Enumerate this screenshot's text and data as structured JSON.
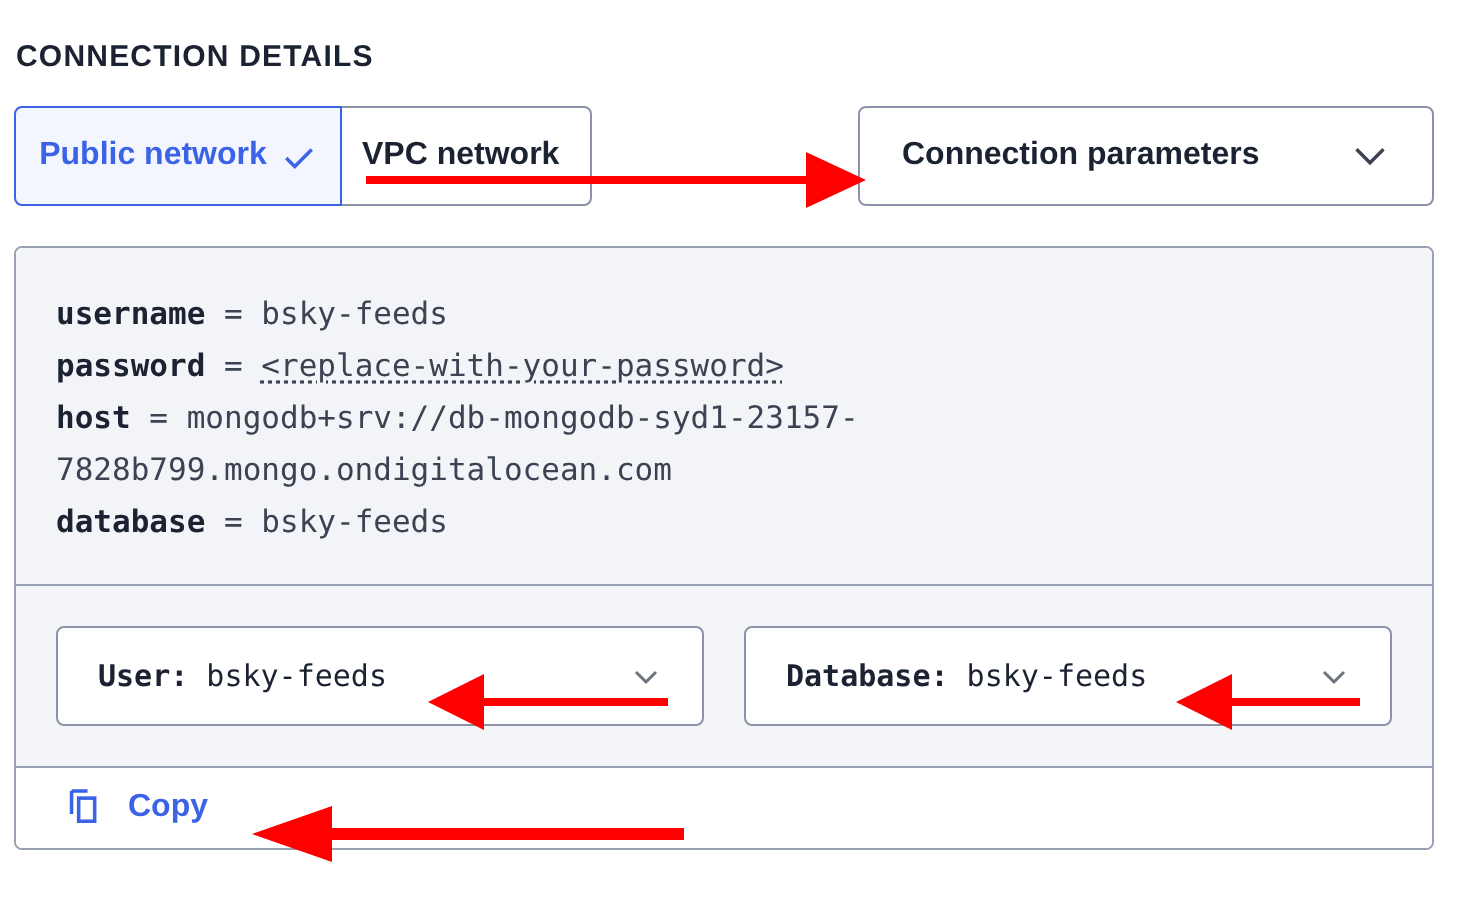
{
  "section_title": "CONNECTION DETAILS",
  "network_tabs": [
    {
      "label": "Public network",
      "selected": true
    },
    {
      "label": "VPC network",
      "selected": false
    }
  ],
  "format_dropdown": {
    "value": "Connection parameters"
  },
  "parameters": [
    {
      "key": "username",
      "operator": "=",
      "value": "bsky-feeds",
      "underlined": false
    },
    {
      "key": "password",
      "operator": "=",
      "value": "<replace-with-your-password>",
      "underlined": true
    },
    {
      "key": "host",
      "operator": "=",
      "value": "mongodb+srv://db-mongodb-syd1-23157-7828b799.mongo.ondigitalocean.com",
      "underlined": false
    },
    {
      "key": "database",
      "operator": "=",
      "value": "bsky-feeds",
      "underlined": false
    }
  ],
  "selects": [
    {
      "label": "User:",
      "value": "bsky-feeds"
    },
    {
      "label": "Database:",
      "value": "bsky-feeds"
    }
  ],
  "copy_button": {
    "label": "Copy"
  }
}
